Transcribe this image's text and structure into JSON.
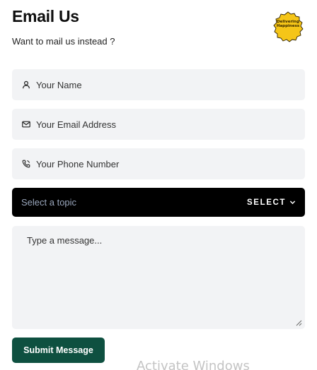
{
  "header": {
    "title": "Email Us",
    "subtitle": "Want to mail us instead ?"
  },
  "badge": {
    "line1": "Delivering",
    "line2": "Happiness",
    "color": "#f5c518",
    "icon": "scalloped-seal-icon"
  },
  "form": {
    "name_placeholder": "Your Name",
    "email_placeholder": "Your Email Address",
    "phone_placeholder": "Your Phone Number",
    "topic_placeholder": "Select a topic",
    "topic_button": "SELECT",
    "message_placeholder": "Type a message...",
    "submit_label": "Submit Message"
  },
  "icons": {
    "name": "user-icon",
    "email": "envelope-icon",
    "phone": "phone-icon",
    "select": "chevron-down-icon"
  },
  "colors": {
    "field_bg": "#f2f3f5",
    "select_bg": "#000000",
    "submit_bg": "#0e5040"
  },
  "overlay": {
    "watermark": "Activate Windows"
  }
}
